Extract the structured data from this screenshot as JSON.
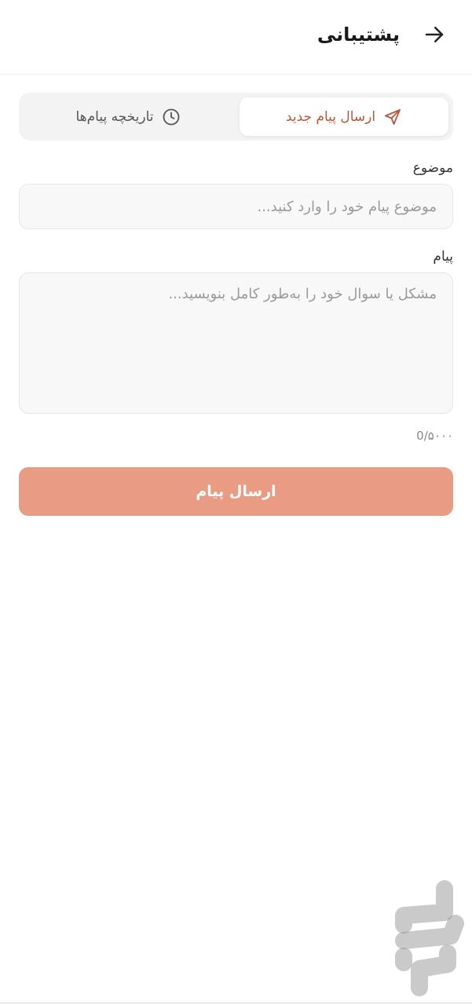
{
  "header": {
    "title": "پشتیبانی"
  },
  "tabs": [
    {
      "label": "ارسال پیام جدید",
      "icon": "send-icon",
      "active": true
    },
    {
      "label": "تاریخچه پیام‌ها",
      "icon": "clock-icon",
      "active": false
    }
  ],
  "form": {
    "subject": {
      "label": "موضوع",
      "placeholder": "موضوع پیام خود را وارد کنید...",
      "value": ""
    },
    "message": {
      "label": "پیام",
      "placeholder": "مشکل یا سوال خود را به‌طور کامل بنویسید...",
      "value": ""
    },
    "counter": "0/۵۰۰۰",
    "submit_label": "ارسال پیام"
  },
  "colors": {
    "accent": "#b9573a",
    "button": "#e89c84",
    "tab_bg": "#f3f3f3",
    "input_bg": "#f8f8f8"
  }
}
